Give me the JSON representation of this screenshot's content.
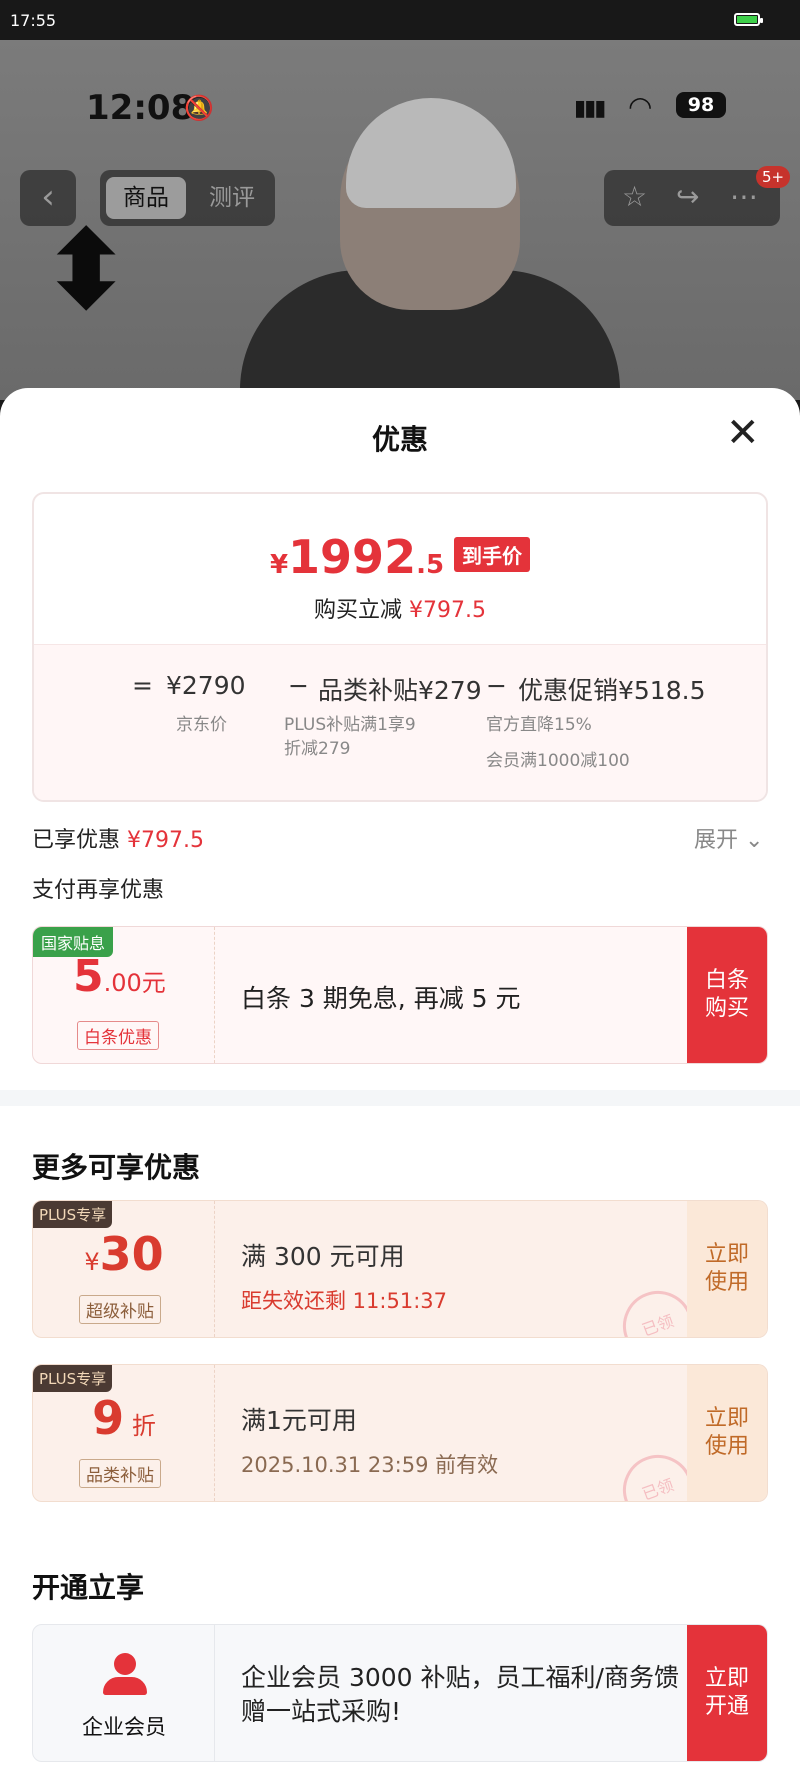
{
  "outer_status": {
    "time": "17:55"
  },
  "inner_status": {
    "time": "12:08",
    "battery": "98"
  },
  "product_header": {
    "tabs": [
      "商品",
      "测评"
    ],
    "badge": "5+"
  },
  "sheet": {
    "title": "优惠",
    "price": {
      "currency": "¥",
      "main": "1992",
      "decimal": ".5",
      "tag": "到手价",
      "instant_label": "购买立减",
      "instant_value": "¥797.5"
    },
    "formula": {
      "eq": "=",
      "jd_price": "¥2790",
      "jd_price_label": "京东价",
      "minus": "−",
      "category_subsidy": "品类补贴¥279",
      "category_note_1": "PLUS补贴满1享9",
      "category_note_2": "折减279",
      "promo": "优惠促销¥518.5",
      "promo_note_1": "官方直降15%",
      "promo_note_2": "会员满1000减100"
    },
    "enjoyed_label": "已享优惠",
    "enjoyed_value": "¥797.5",
    "expand_label": "展开",
    "pay_title": "支付再享优惠",
    "pay_card": {
      "tag": "国家贴息",
      "amount_int": "5",
      "amount_rest": ".00元",
      "sub_tag": "白条优惠",
      "text": "白条 3 期免息, 再减 5 元",
      "action_1": "白条",
      "action_2": "购买"
    },
    "more_title": "更多可享优惠",
    "coupons": [
      {
        "plus": "PLUS专享",
        "val_prefix": "¥",
        "val": "30",
        "val_suffix": "",
        "tag": "超级补贴",
        "cond": "满 300 元可用",
        "sub": "距失效还剩 11:51:37",
        "stamp": "已领",
        "action_1": "立即",
        "action_2": "使用"
      },
      {
        "plus": "PLUS专享",
        "val_prefix": "",
        "val": "9",
        "val_suffix": " 折",
        "tag": "品类补贴",
        "cond": "满1元可用",
        "sub": "2025.10.31 23:59 前有效",
        "stamp": "已领",
        "action_1": "立即",
        "action_2": "使用"
      }
    ],
    "open_title": "开通立享",
    "enterprise": {
      "label": "企业会员",
      "text": "企业会员 3000 补贴，员工福利/商务馈赠一站式采购!",
      "action_1": "立即",
      "action_2": "开通"
    }
  },
  "colors": {
    "accent": "#e4333a",
    "plus_bg": "#4b3a33",
    "green_tag": "#3aa14a"
  }
}
